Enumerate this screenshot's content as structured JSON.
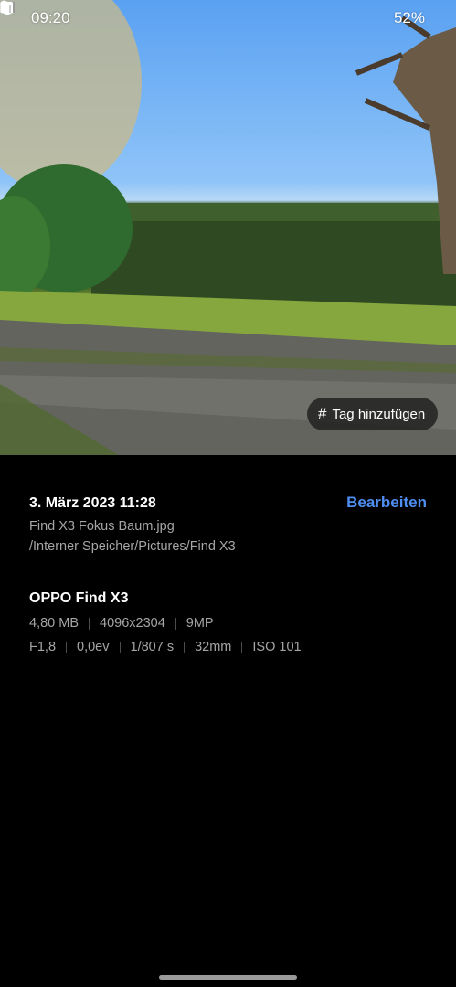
{
  "status_bar": {
    "time": "09:20",
    "battery": "52%",
    "icons": [
      "gallery-notification-icon",
      "alarm-icon",
      "mute-icon",
      "wifi-icon",
      "signal-icon",
      "battery-icon"
    ]
  },
  "photo": {
    "tag_button_label": "Tag hinzufügen",
    "tag_icon": "#"
  },
  "details": {
    "date": "3. März 2023 11:28",
    "edit_label": "Bearbeiten",
    "filename": "Find X3 Fokus Baum.jpg",
    "path": "/Interner Speicher/Pictures/Find X3",
    "device": "OPPO Find X3",
    "file_info": [
      "4,80 MB",
      "4096x2304",
      "9MP"
    ],
    "exif": [
      "F1,8",
      "0,0ev",
      "1/807 s",
      "32mm",
      "ISO 101"
    ]
  },
  "colors": {
    "accent": "#4e8ef0",
    "background": "#000000",
    "secondary_text": "#a5a5a5"
  }
}
